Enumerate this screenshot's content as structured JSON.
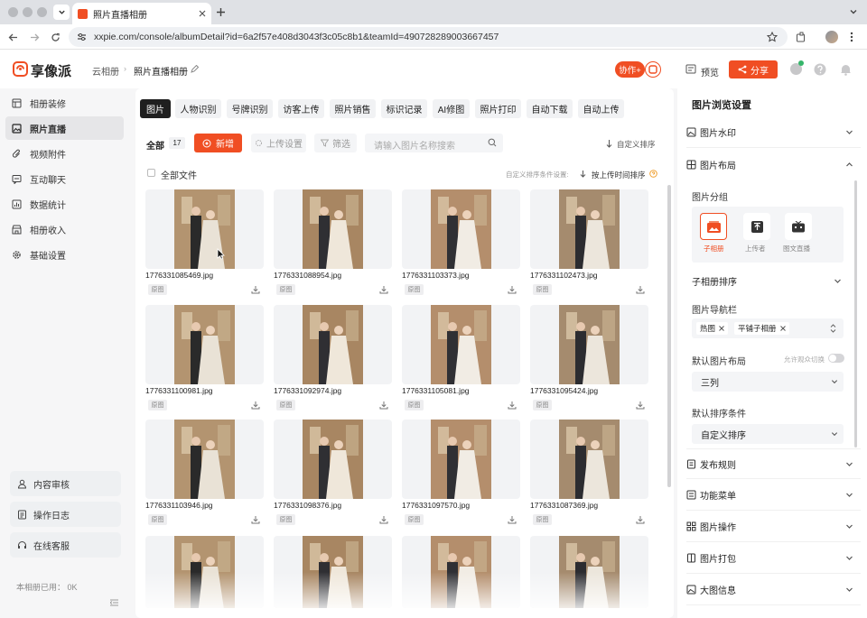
{
  "browser": {
    "tab_title": "照片直播相册",
    "url": "xxpie.com/console/albumDetail?id=6a2f57e408d3043f3c05c8b1&teamId=490728289003667457"
  },
  "header": {
    "logo_text": "享像派",
    "breadcrumb": [
      "云相册",
      "照片直播相册"
    ],
    "collab_label": "协作+",
    "preview_label": "预览",
    "share_label": "分享",
    "colors": {
      "brand": "#f04e23"
    }
  },
  "sidebar": {
    "items": [
      {
        "label": "相册装修",
        "icon": "layout-icon"
      },
      {
        "label": "照片直播",
        "icon": "image-icon"
      },
      {
        "label": "视频附件",
        "icon": "paperclip-icon"
      },
      {
        "label": "互动聊天",
        "icon": "chat-icon"
      },
      {
        "label": "数据统计",
        "icon": "chart-icon"
      },
      {
        "label": "相册收入",
        "icon": "shop-icon"
      },
      {
        "label": "基础设置",
        "icon": "gear-icon"
      }
    ],
    "bottom": [
      {
        "label": "内容审核",
        "icon": "user-check-icon"
      },
      {
        "label": "操作日志",
        "icon": "log-icon"
      },
      {
        "label": "在线客服",
        "icon": "headset-icon"
      }
    ],
    "usage": "本相册已用：  0K"
  },
  "main": {
    "tabs": [
      "图片",
      "人物识别",
      "号牌识别",
      "访客上传",
      "照片销售",
      "标识记录",
      "AI修图",
      "照片打印",
      "自动下载",
      "自动上传"
    ],
    "filter": {
      "all_label": "全部",
      "count": "17",
      "new_label": "新增",
      "upload_settings_label": "上传设置",
      "filter_label": "筛选",
      "search_placeholder": "请输入图片名称搜索",
      "custom_sort_label": "自定义排序"
    },
    "select_all_label": "全部文件",
    "sort_condition_label": "自定义排序条件设置:",
    "sort_value": "按上传时间排序",
    "badge_label": "原图",
    "photos": [
      "1776331085469.jpg",
      "1776331088954.jpg",
      "1776331103373.jpg",
      "1776331102473.jpg",
      "1776331100981.jpg",
      "1776331092974.jpg",
      "1776331105081.jpg",
      "1776331095424.jpg",
      "1776331103946.jpg",
      "1776331098376.jpg",
      "1776331097570.jpg",
      "1776331087369.jpg",
      "",
      "",
      "",
      ""
    ]
  },
  "right_panel": {
    "title": "图片浏览设置",
    "watermark": "图片水印",
    "layout": "图片布局",
    "group_label": "图片分组",
    "group_options": [
      "子相册",
      "上传者",
      "图文直播"
    ],
    "sub_album_sort": "子相册排序",
    "nav_label": "图片导航栏",
    "nav_tags": [
      "热图",
      "平铺子相册"
    ],
    "default_layout_label": "默认图片布局",
    "allow_switch_label": "允许观众切换",
    "default_layout_value": "三列",
    "default_sort_label": "默认排序条件",
    "default_sort_value": "自定义排序",
    "sections": [
      "发布规则",
      "功能菜单",
      "图片操作",
      "图片打包",
      "大图信息"
    ]
  }
}
